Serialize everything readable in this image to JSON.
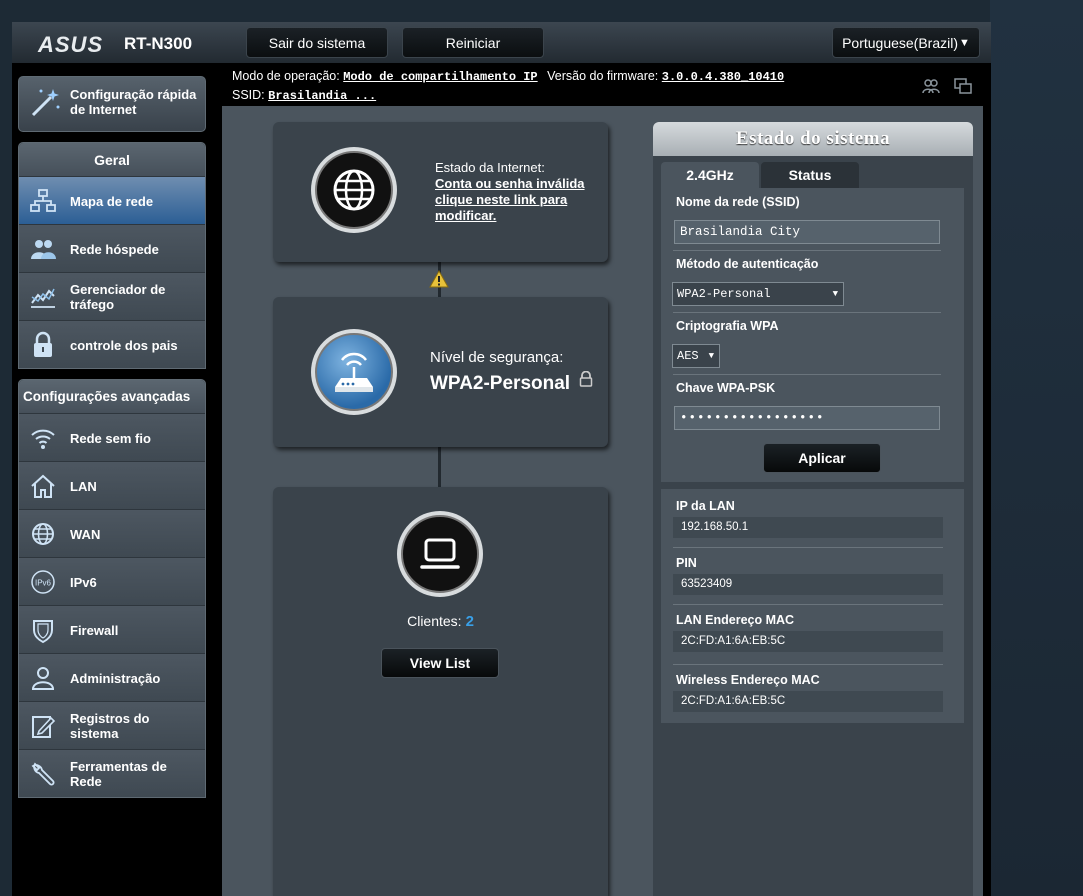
{
  "header": {
    "brand": "ASUS",
    "model": "RT-N300",
    "logout_label": "Sair do sistema",
    "reboot_label": "Reiniciar",
    "language": "Portuguese(Brazil)"
  },
  "info": {
    "mode_label": "Modo de operação:",
    "mode_value": "Modo de compartilhamento IP",
    "firmware_label": "Versão do firmware:",
    "firmware_value": "3.0.0.4.380_10410",
    "ssid_label": "SSID:",
    "ssid_value": "Brasilandia ..."
  },
  "sidebar": {
    "quick_setup": "Configuração rápida de Internet",
    "general_title": "Geral",
    "general_items": [
      {
        "label": "Mapa de rede",
        "icon": "network-map-icon"
      },
      {
        "label": "Rede hóspede",
        "icon": "guest-network-icon"
      },
      {
        "label": "Gerenciador de tráfego",
        "icon": "traffic-icon"
      },
      {
        "label": "controle dos pais",
        "icon": "lock-icon"
      }
    ],
    "advanced_title": "Configurações avançadas",
    "advanced_items": [
      {
        "label": "Rede sem fio",
        "icon": "wifi-icon"
      },
      {
        "label": "LAN",
        "icon": "home-icon"
      },
      {
        "label": "WAN",
        "icon": "globe-icon"
      },
      {
        "label": "IPv6",
        "icon": "ipv6-icon"
      },
      {
        "label": "Firewall",
        "icon": "shield-icon"
      },
      {
        "label": "Administração",
        "icon": "user-icon"
      },
      {
        "label": "Registros do sistema",
        "icon": "log-icon"
      },
      {
        "label": "Ferramentas de Rede",
        "icon": "wrench-icon"
      }
    ]
  },
  "map": {
    "internet_label": "Estado da Internet:",
    "internet_link": "Conta ou senha inválida clique neste link para modificar.",
    "security_label": "Nível de segurança:",
    "security_value": "WPA2-Personal",
    "clients_label": "Clientes:",
    "clients_count": "2",
    "view_list": "View List"
  },
  "status": {
    "title": "Estado do sistema",
    "tab_active": "2.4GHz",
    "tab_inactive": "Status",
    "ssid_label": "Nome da rede (SSID)",
    "ssid_value": "Brasilandia City",
    "auth_label": "Método de autenticação",
    "auth_value": "WPA2-Personal",
    "crypto_label": "Criptografia WPA",
    "crypto_value": "AES",
    "psk_label": "Chave WPA-PSK",
    "psk_value": "•••••••••••••••••",
    "apply_label": "Aplicar",
    "lan_ip_label": "IP da LAN",
    "lan_ip_value": "192.168.50.1",
    "pin_label": "PIN",
    "pin_value": "63523409",
    "lan_mac_label": "LAN Endereço MAC",
    "lan_mac_value": "2C:FD:A1:6A:EB:5C",
    "wl_mac_label": "Wireless Endereço MAC",
    "wl_mac_value": "2C:FD:A1:6A:EB:5C"
  },
  "colors": {
    "active_item": "#2c5f95",
    "accent_blue": "#39a0e8",
    "panel": "#4b555e"
  }
}
